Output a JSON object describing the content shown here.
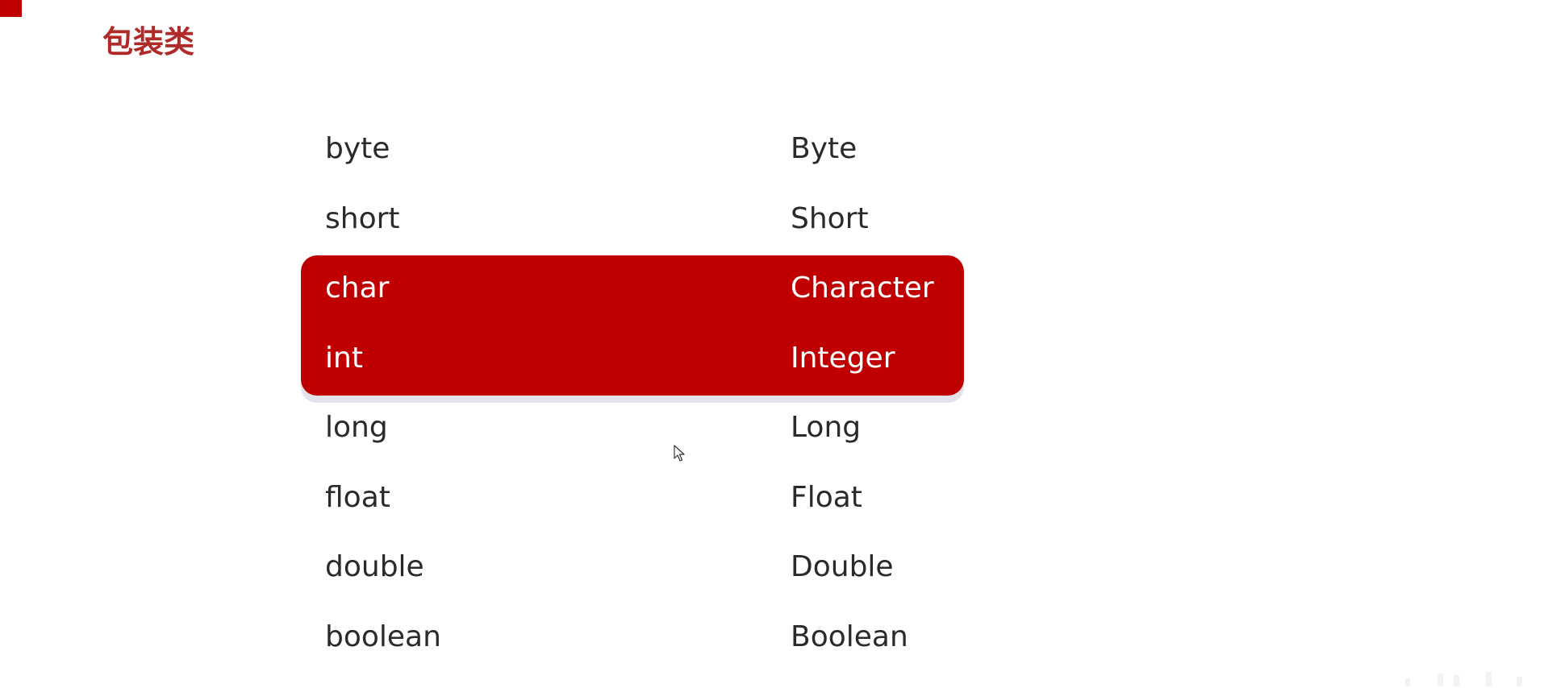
{
  "page": {
    "title": "包装类",
    "accent_color": "#c00000",
    "title_color": "#b02a2a"
  },
  "table": {
    "rows": [
      {
        "primitive": "byte",
        "wrapper": "Byte",
        "highlighted": false
      },
      {
        "primitive": "short",
        "wrapper": "Short",
        "highlighted": false
      },
      {
        "primitive": "char",
        "wrapper": "Character",
        "highlighted": true
      },
      {
        "primitive": "int",
        "wrapper": "Integer",
        "highlighted": true
      },
      {
        "primitive": "long",
        "wrapper": "Long",
        "highlighted": false
      },
      {
        "primitive": "float",
        "wrapper": "Float",
        "highlighted": false
      },
      {
        "primitive": "double",
        "wrapper": "Double",
        "highlighted": false
      },
      {
        "primitive": "boolean",
        "wrapper": "Boolean",
        "highlighted": false
      }
    ]
  },
  "icons": {
    "cursor": "mouse-cursor-icon"
  }
}
